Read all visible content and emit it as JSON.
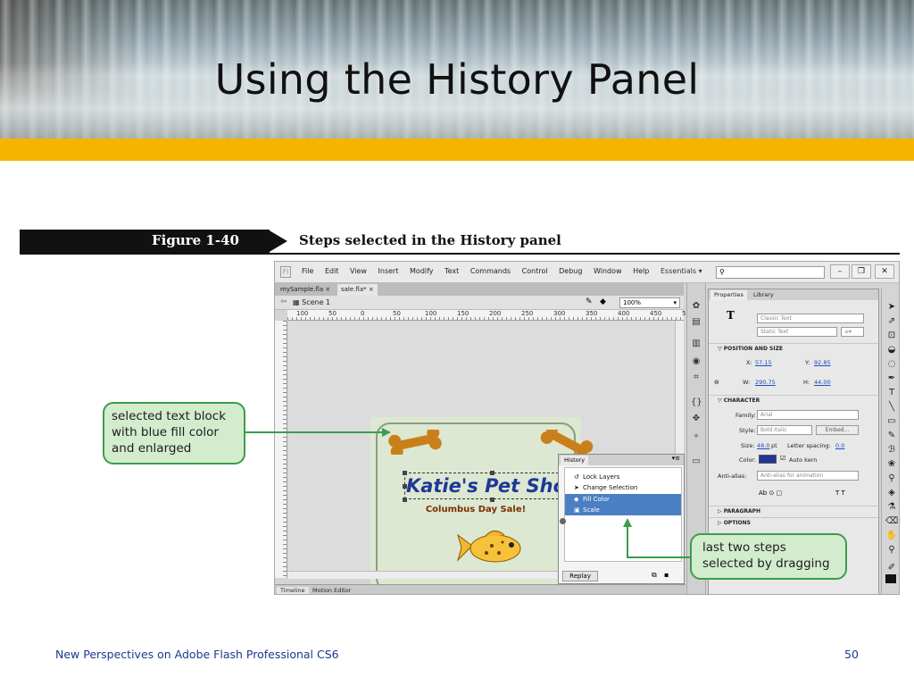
{
  "slide": {
    "title": "Using the History Panel",
    "footer_left": "New Perspectives on Adobe Flash Professional CS6",
    "page_number": "50"
  },
  "figure": {
    "number": "Figure 1-40",
    "caption": "Steps selected in the History panel"
  },
  "app": {
    "menu": [
      "File",
      "Edit",
      "View",
      "Insert",
      "Modify",
      "Text",
      "Commands",
      "Control",
      "Debug",
      "Window",
      "Help"
    ],
    "workspace": "Essentials",
    "search_placeholder": "",
    "doc_tabs": [
      {
        "label": "mySample.fla ×"
      },
      {
        "label": "sale.fla* ×"
      }
    ],
    "scene_label": "Scene 1",
    "zoom": "100%",
    "ruler_numbers": [
      "100",
      "50",
      "0",
      "50",
      "100",
      "150",
      "200",
      "250",
      "300",
      "350",
      "400",
      "450",
      "500"
    ],
    "stage": {
      "title": "Katie's Pet Shop",
      "subtitle": "Columbus Day Sale!"
    },
    "history": {
      "tab": "History",
      "steps": [
        {
          "label": "Lock Layers",
          "selected": false
        },
        {
          "label": "Change Selection",
          "selected": false
        },
        {
          "label": "Fill Color",
          "selected": true
        },
        {
          "label": "Scale",
          "selected": true
        }
      ],
      "replay_label": "Replay"
    },
    "properties": {
      "tabs": [
        "Properties",
        "Library"
      ],
      "text_type": "Classic Text",
      "text_subtype": "Static Text",
      "section_position": "POSITION AND SIZE",
      "x_label": "X:",
      "x_value": "57.15",
      "y_label": "Y:",
      "y_value": "92.85",
      "w_label": "W:",
      "w_value": "290.75",
      "h_label": "H:",
      "h_value": "44.00",
      "section_character": "CHARACTER",
      "family_label": "Family:",
      "family_value": "Arial",
      "style_label": "Style:",
      "style_value": "Bold Italic",
      "embed_label": "Embed...",
      "size_label": "Size:",
      "size_value": "48.0",
      "size_unit": "pt",
      "letter_spacing_label": "Letter spacing:",
      "letter_spacing_value": "0.0",
      "color_label": "Color:",
      "auto_kern_label": "Auto kern",
      "antialias_label": "Anti-alias:",
      "antialias_value": "Anti-alias for animation",
      "section_paragraph": "PARAGRAPH",
      "section_options": "OPTIONS",
      "fill_color": "#1f3796"
    },
    "timeline_tabs": [
      "Timeline",
      "Motion Editor"
    ]
  },
  "callouts": {
    "left": "selected text block with blue fill color and enlarged",
    "right": "last two steps selected by dragging"
  },
  "colors": {
    "gold_bar": "#f5b400",
    "callout_fill": "#d2eccd",
    "callout_border": "#3a9d4a",
    "history_selection": "#4a7fc4",
    "footer_text": "#1a3a8a"
  }
}
